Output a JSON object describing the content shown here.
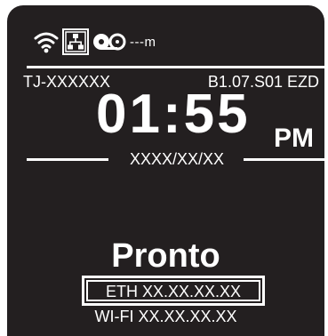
{
  "status_bar": {
    "icons": [
      "wifi-icon",
      "ethernet-network-icon",
      "tape-reel-icon"
    ],
    "distance": "---m"
  },
  "header": {
    "model": "TJ-XXXXXX",
    "firmware": "B1.07.S01 EZD"
  },
  "clock": {
    "time": "01:55",
    "ampm": "PM",
    "date": "XXXX/XX/XX"
  },
  "main": {
    "status": "Pronto",
    "ethernet_address": "ETH XX.XX.XX.XX",
    "wifi_address": "WI-FI XX.XX.XX.XX"
  },
  "colors": {
    "background": "#231f20",
    "foreground": "#ffffff"
  }
}
